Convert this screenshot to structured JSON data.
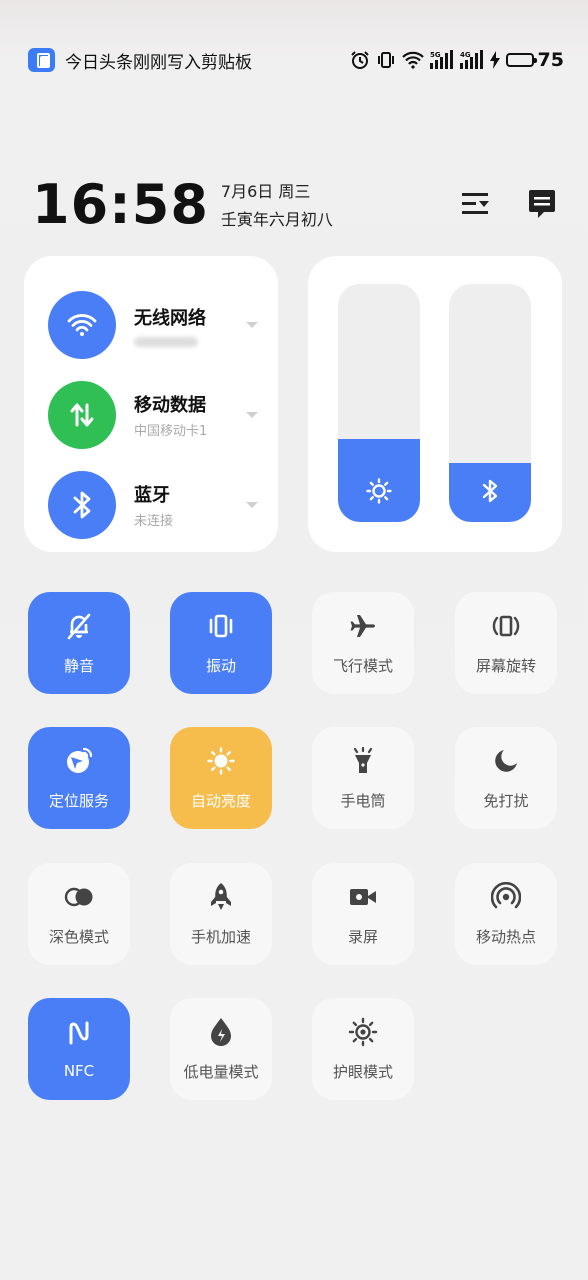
{
  "status_bar": {
    "notification_text": "今日头条刚刚写入剪贴板",
    "battery_percent": "75",
    "battery_level": 0.75,
    "icons": [
      "alarm-icon",
      "vibrate-icon",
      "wifi-icon",
      "signal-5g-icon",
      "signal-4g-icon",
      "charging-icon",
      "battery-icon"
    ],
    "signal_labels": {
      "sim1": "5G",
      "sim2": "4G"
    }
  },
  "header": {
    "time": "16:58",
    "date": "7月6日 周三",
    "lunar_date": "壬寅年六月初八"
  },
  "connectivity": [
    {
      "id": "wifi",
      "title": "无线网络",
      "subtitle": "",
      "color": "#4a7ef7",
      "icon": "wifi-icon"
    },
    {
      "id": "mobile-data",
      "title": "移动数据",
      "subtitle": "中国移动卡1",
      "color": "#2fbf55",
      "icon": "data-transfer-icon"
    },
    {
      "id": "bluetooth",
      "title": "蓝牙",
      "subtitle": "未连接",
      "color": "#4a7ef7",
      "icon": "bluetooth-icon"
    }
  ],
  "sliders": {
    "brightness": {
      "level": 0.35,
      "icon": "sun-icon"
    },
    "volume": {
      "level": 0.25,
      "icon": "bluetooth-icon"
    }
  },
  "tiles": [
    {
      "label": "静音",
      "state": "on",
      "icon": "bell-off-icon"
    },
    {
      "label": "振动",
      "state": "on",
      "icon": "vibrate-icon"
    },
    {
      "label": "飞行模式",
      "state": "off",
      "icon": "airplane-icon"
    },
    {
      "label": "屏幕旋转",
      "state": "off",
      "icon": "rotate-icon"
    },
    {
      "label": "定位服务",
      "state": "on",
      "icon": "location-icon"
    },
    {
      "label": "自动亮度",
      "state": "warm",
      "icon": "sun-icon"
    },
    {
      "label": "手电筒",
      "state": "off",
      "icon": "flashlight-icon"
    },
    {
      "label": "免打扰",
      "state": "off",
      "icon": "moon-icon"
    },
    {
      "label": "深色模式",
      "state": "off",
      "icon": "dark-mode-icon"
    },
    {
      "label": "手机加速",
      "state": "off",
      "icon": "rocket-icon"
    },
    {
      "label": "录屏",
      "state": "off",
      "icon": "video-camera-icon"
    },
    {
      "label": "移动热点",
      "state": "off",
      "icon": "hotspot-icon"
    },
    {
      "label": "NFC",
      "state": "on",
      "icon": "nfc-icon"
    },
    {
      "label": "低电量模式",
      "state": "off",
      "icon": "battery-saver-icon"
    },
    {
      "label": "护眼模式",
      "state": "off",
      "icon": "eye-care-icon"
    }
  ],
  "colors": {
    "accent": "#4a7ef7",
    "green": "#2fbf55",
    "warm": "#f7bd4c",
    "tile_off": "#f7f7f7"
  }
}
